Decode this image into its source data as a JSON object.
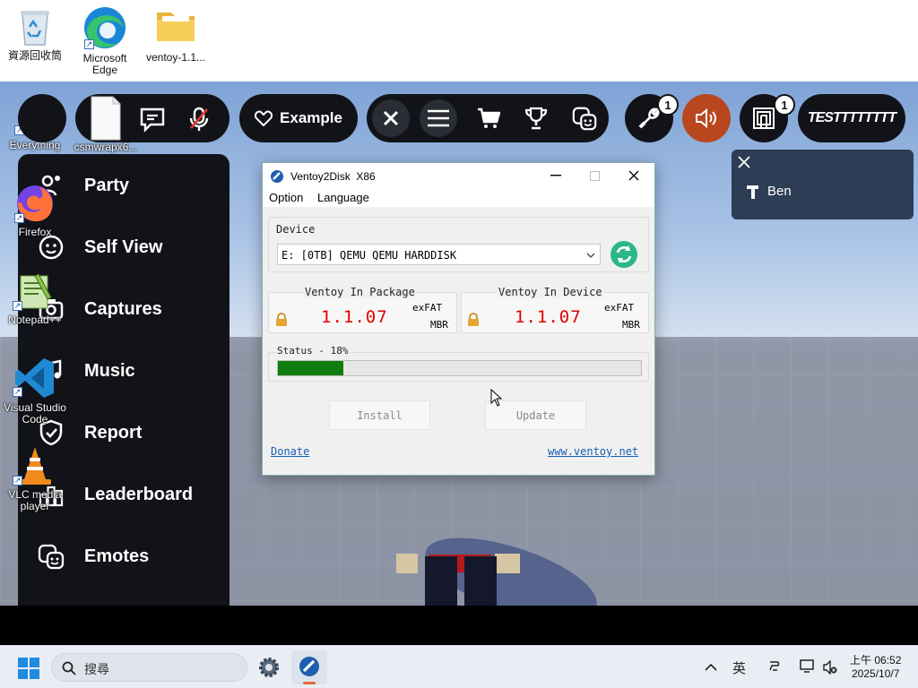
{
  "desktop": {
    "top_icons": [
      {
        "label": "資源回收筒"
      },
      {
        "label": "Microsoft Edge"
      },
      {
        "label": "ventoy-1.1..."
      }
    ],
    "side_icons": [
      {
        "label": "Everything"
      },
      {
        "label": "csmwrapx6..."
      },
      {
        "label": "Firefox"
      },
      {
        "label": "Notepad++"
      },
      {
        "label": "Visual Studio Code"
      },
      {
        "label": "VLC media player"
      }
    ]
  },
  "roblox": {
    "topbar": {
      "example_label": "Example",
      "tools_badge": "1",
      "inventory_badge": "1",
      "username": "TESTTTTTTTT"
    },
    "menu_items": [
      {
        "label": "Party",
        "icon": "party-icon"
      },
      {
        "label": "Self View",
        "icon": "self-view-icon"
      },
      {
        "label": "Captures",
        "icon": "captures-icon"
      },
      {
        "label": "Music",
        "icon": "music-icon"
      },
      {
        "label": "Report",
        "icon": "report-icon"
      },
      {
        "label": "Leaderboard",
        "icon": "leaderboard-icon"
      },
      {
        "label": "Emotes",
        "icon": "emotes-icon"
      }
    ],
    "notification": {
      "player": "Ben"
    }
  },
  "ventoy": {
    "title": "Ventoy2Disk  X86",
    "menu": [
      "Option",
      "Language"
    ],
    "device_label": "Device",
    "device_value": "E: [0TB] QEMU QEMU HARDDISK",
    "package_label": "Ventoy In Package",
    "device_version_label": "Ventoy In Device",
    "package_version": "1.1.07",
    "device_version": "1.1.07",
    "package_fs": "exFAT",
    "package_part": "MBR",
    "device_fs": "exFAT",
    "device_part": "MBR",
    "status_label": "Status - 18%",
    "progress": 0.18,
    "install_label": "Install",
    "update_label": "Update",
    "donate_label": "Donate",
    "website_label": "www.ventoy.net",
    "accent_red": "#e00000",
    "progress_green": "#0f7d0f"
  },
  "taskbar": {
    "search_placeholder": "搜尋",
    "ime_label": "英",
    "clock_time": "上午 06:52",
    "clock_date": "2025/10/7"
  }
}
